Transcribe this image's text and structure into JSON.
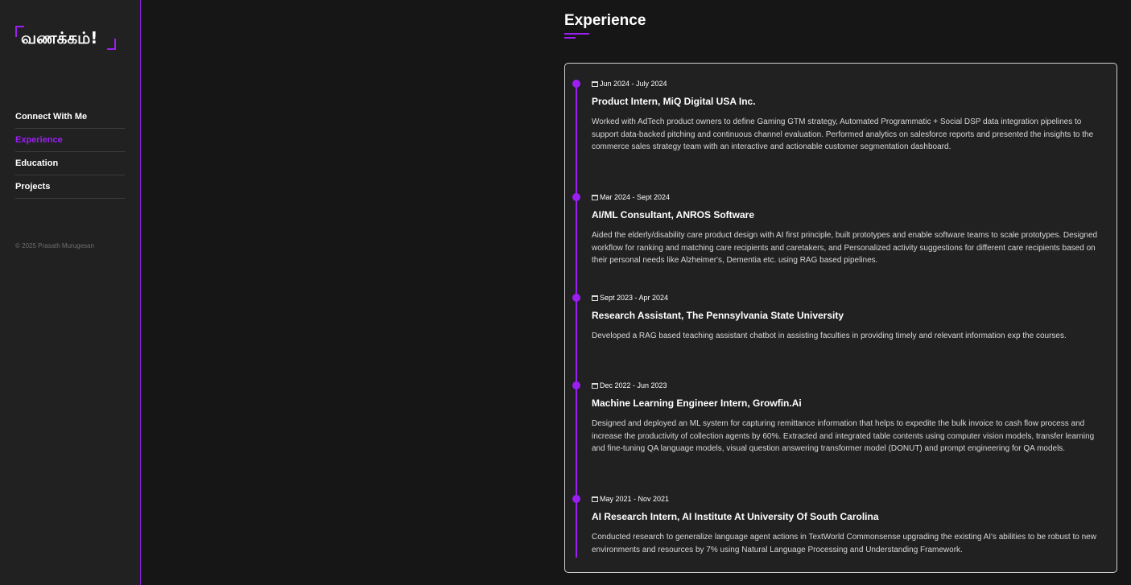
{
  "sidebar": {
    "logo_text": "வணக்கம்!",
    "nav": [
      {
        "label": "Connect With Me",
        "active": false
      },
      {
        "label": "Experience",
        "active": true
      },
      {
        "label": "Education",
        "active": false
      },
      {
        "label": "Projects",
        "active": false
      }
    ],
    "copyright": "© 2025 Prasath Murugesan"
  },
  "main": {
    "section_title": "Experience",
    "accent_color": "#9b1ff3",
    "entries": [
      {
        "date": "Jun 2024 - July 2024",
        "role": "Product Intern, MiQ Digital USA Inc.",
        "description": "Worked with AdTech product owners to define Gaming GTM strategy, Automated Programmatic + Social DSP data integration pipelines to support data-backed pitching and continuous channel evaluation. Performed analytics on salesforce reports and presented the insights to the commerce sales strategy team with an interactive and actionable customer segmentation dashboard."
      },
      {
        "date": "Mar 2024 - Sept 2024",
        "role": "AI/ML Consultant, ANROS Software",
        "description": "Aided the elderly/disability care product design with AI first principle, built prototypes and enable software teams to scale prototypes. Designed workflow for ranking and matching care recipients and caretakers, and Personalized activity suggestions for different care recipients based on their personal needs like Alzheimer's, Dementia etc. using RAG based pipelines."
      },
      {
        "date": "Sept 2023 - Apr 2024",
        "role": "Research Assistant, The Pennsylvania State University",
        "description": "Developed a RAG based teaching assistant chatbot in assisting faculties in providing timely and relevant information exp the courses."
      },
      {
        "date": "Dec 2022 - Jun 2023",
        "role": "Machine Learning Engineer Intern, Growfin.Ai",
        "description": "Designed and deployed an ML system for capturing remittance information that helps to expedite the bulk invoice to cash flow process and increase the productivity of collection agents by 60%. Extracted and integrated table contents using computer vision models, transfer learning and fine-tuning QA language models, visual question answering transformer model (DONUT) and prompt engineering for QA models."
      },
      {
        "date": "May 2021 - Nov 2021",
        "role": "AI Research Intern, AI Institute At University Of South Carolina",
        "description": "Conducted research to generalize language agent actions in TextWorld Commonsense upgrading the existing AI's abilities to be robust to new environments and resources by 7% using Natural Language Processing and Understanding Framework."
      }
    ]
  }
}
